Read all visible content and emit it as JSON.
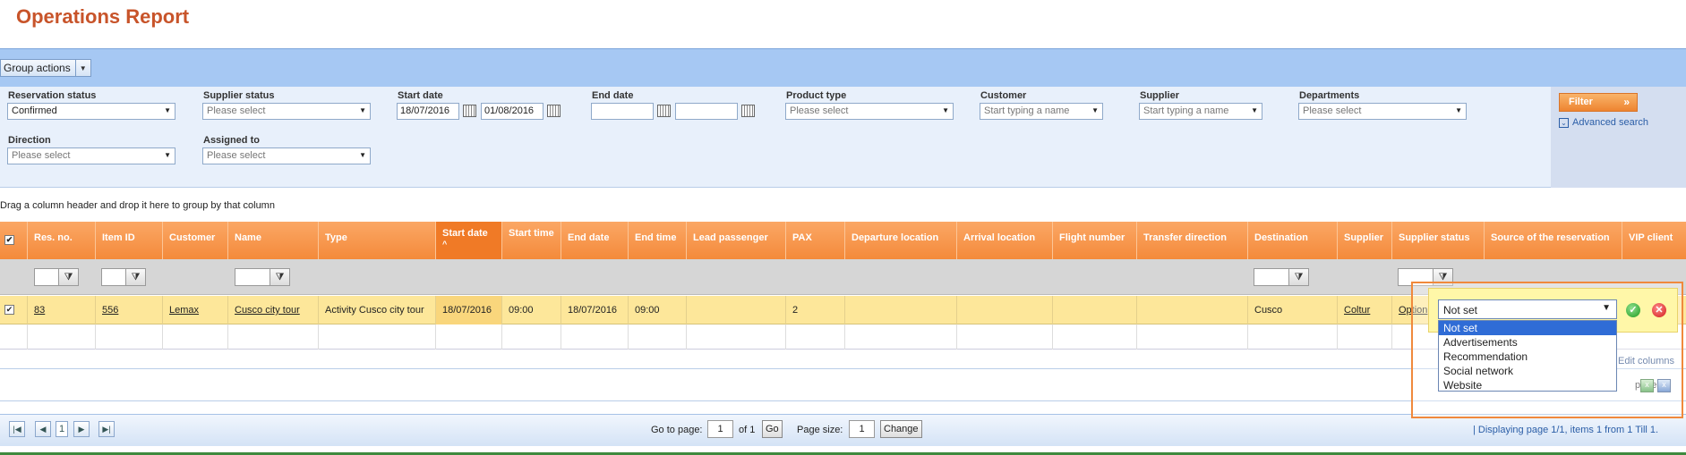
{
  "page": {
    "title": "Operations Report"
  },
  "toolbar": {
    "group_actions_label": "Group actions"
  },
  "filters": {
    "reservation_status": {
      "label": "Reservation status",
      "value": "Confirmed"
    },
    "supplier_status": {
      "label": "Supplier status",
      "placeholder": "Please select"
    },
    "start_date": {
      "label": "Start date",
      "from": "18/07/2016",
      "to": "01/08/2016"
    },
    "end_date": {
      "label": "End date",
      "from": "",
      "to": ""
    },
    "product_type": {
      "label": "Product type",
      "placeholder": "Please select"
    },
    "customer": {
      "label": "Customer",
      "placeholder": "Start typing a name"
    },
    "supplier": {
      "label": "Supplier",
      "placeholder": "Start typing a name"
    },
    "departments": {
      "label": "Departments",
      "placeholder": "Please select"
    },
    "direction": {
      "label": "Direction",
      "placeholder": "Please select"
    },
    "assigned_to": {
      "label": "Assigned to",
      "placeholder": "Please select"
    },
    "filter_button": "Filter",
    "advanced_search": "Advanced search"
  },
  "grid": {
    "group_hint": "Drag a column header and drop it here to group by that column",
    "columns": [
      "Res. no.",
      "Item ID",
      "Customer",
      "Name",
      "Type",
      "Start date",
      "Start time",
      "End date",
      "End time",
      "Lead passenger",
      "PAX",
      "Departure location",
      "Arrival location",
      "Flight number",
      "Transfer direction",
      "Destination",
      "Supplier",
      "Supplier status",
      "Source of the reservation",
      "VIP client"
    ],
    "row": {
      "res_no": "83",
      "item_id": "556",
      "customer": "Lemax",
      "name": "Cusco city tour",
      "type": "Activity Cusco city tour",
      "start_date": "18/07/2016",
      "start_time": "09:00",
      "end_date": "18/07/2016",
      "end_time": "09:00",
      "lead_passenger": "",
      "pax": "2",
      "departure_location": "",
      "arrival_location": "",
      "flight_number": "",
      "transfer_direction": "",
      "destination": "Cusco",
      "supplier": "Coltur",
      "supplier_status": "Option"
    },
    "edit_columns": "Edit columns",
    "page_export_label": "page"
  },
  "popup": {
    "selected": "Not set",
    "options": [
      "Not set",
      "Advertisements",
      "Recommendation",
      "Social network",
      "Website"
    ]
  },
  "pager": {
    "current_page": "1",
    "go_to_page_label": "Go to page:",
    "go_to_value": "1",
    "of_label": "of 1",
    "go_label": "Go",
    "page_size_label": "Page size:",
    "page_size_value": "1",
    "change_label": "Change",
    "status": "| Displaying page 1/1, items 1 from 1 Till 1."
  }
}
